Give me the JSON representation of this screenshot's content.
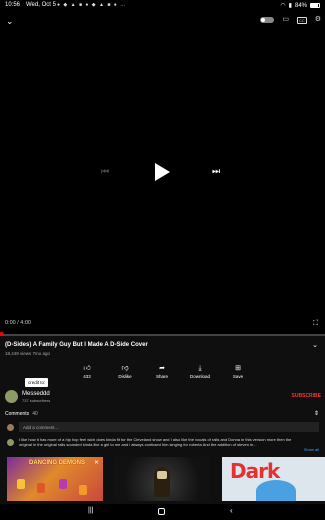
{
  "status_bar": {
    "time": "10:56",
    "date": "Wed, Oct 5",
    "notification_icons": "● ◆ ▲ ■ ● ◆ ▲ ■ ● …",
    "battery": "84%"
  },
  "player": {
    "time_display": "0:00 / 4:00",
    "progress": 0.0,
    "autoplay_on": false
  },
  "video": {
    "title": "(D-Sides) A Family Guy But I Made A D-Side Cover",
    "meta": "18,449 views  7mo ago",
    "actions": [
      {
        "label": "433",
        "icon": "thumbs-up-icon"
      },
      {
        "label": "Dislike",
        "icon": "thumbs-down-icon"
      },
      {
        "label": "Share",
        "icon": "share-icon"
      },
      {
        "label": "Download",
        "icon": "download-icon"
      },
      {
        "label": "Save",
        "icon": "save-icon"
      }
    ]
  },
  "channel": {
    "name": "Messeddd",
    "subscribers": "737 subscribers",
    "subscribe_label": "SUBSCRIBE",
    "tooltip": "credit to:"
  },
  "comments": {
    "heading": "Comments",
    "count": "40",
    "placeholder": "Add a comment...",
    "top_comment": "I like how it has more of a hip hop feel wich does kinda fit for the Cleveland show and I also like the vocals of ralls and Donna in this version   more then the original  in the original ralls sounded kinda like a girl to me  and i always confused him singing for roberta   And the addition of steven in...",
    "show_all": "Show all"
  },
  "recommended": {
    "thumb1_text": "DANCING DEMONS"
  },
  "colors": {
    "accent_red": "#ff0000",
    "subscribe_red": "#ff3333",
    "background": "#0f0f0f"
  }
}
